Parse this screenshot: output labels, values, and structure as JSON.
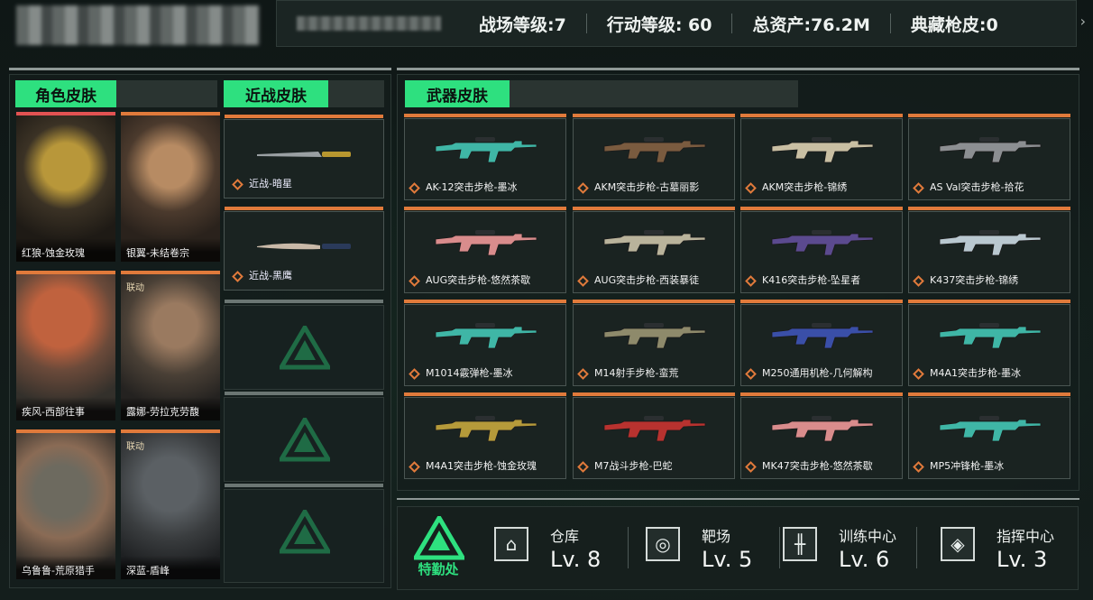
{
  "header": {
    "battlefield_level": "战场等级:7",
    "action_level": "行动等级: 60",
    "total_assets": "总资产:76.2M",
    "collection_skins": "典藏枪皮:0"
  },
  "sections": {
    "characters": "角色皮肤",
    "melee": "近战皮肤",
    "weapons": "武器皮肤"
  },
  "characters": [
    {
      "name": "红狼-蚀金玫瑰",
      "collab": ""
    },
    {
      "name": "银翼-未结卷宗",
      "collab": ""
    },
    {
      "name": "疾风-西部往事",
      "collab": ""
    },
    {
      "name": "露娜-劳拉克劳馥",
      "collab": "联动"
    },
    {
      "name": "乌鲁鲁-荒原猎手",
      "collab": ""
    },
    {
      "name": "深蓝-盾峰",
      "collab": "联动"
    }
  ],
  "melee": [
    {
      "name": "近战-暗星"
    },
    {
      "name": "近战-黑鹰"
    }
  ],
  "weapons": [
    {
      "name": "AK-12突击步枪-墨冰",
      "color": "#3fb6a6"
    },
    {
      "name": "AKM突击步枪-古墓丽影",
      "color": "#7a5b3f"
    },
    {
      "name": "AKM突击步枪-锦绣",
      "color": "#c9bfa3"
    },
    {
      "name": "AS Val突击步枪-拾花",
      "color": "#8c8f92"
    },
    {
      "name": "AUG突击步枪-悠然茶歇",
      "color": "#d98c8c"
    },
    {
      "name": "AUG突击步枪-西装暴徒",
      "color": "#b9b39b"
    },
    {
      "name": "K416突击步枪-坠星者",
      "color": "#5b4a8f"
    },
    {
      "name": "K437突击步枪-锦绣",
      "color": "#b9c8d0"
    },
    {
      "name": "M1014霰弹枪-墨冰",
      "color": "#3fb6a6"
    },
    {
      "name": "M14射手步枪-蛮荒",
      "color": "#8e8a6b"
    },
    {
      "name": "M250通用机枪-几何解构",
      "color": "#3a4fa8"
    },
    {
      "name": "M4A1突击步枪-墨冰",
      "color": "#3fb6a6"
    },
    {
      "name": "M4A1突击步枪-蚀金玫瑰",
      "color": "#b59a3a"
    },
    {
      "name": "M7战斗步枪-巴蛇",
      "color": "#b8322f"
    },
    {
      "name": "MK47突击步枪-悠然茶歇",
      "color": "#d98c8c"
    },
    {
      "name": "MP5冲锋枪-墨冰",
      "color": "#3fb6a6"
    }
  ],
  "hq": {
    "name": "特勤处",
    "facilities": [
      {
        "name": "仓库",
        "level": "Lv. 8",
        "icon": "warehouse-icon"
      },
      {
        "name": "靶场",
        "level": "Lv. 5",
        "icon": "target-icon"
      },
      {
        "name": "训练中心",
        "level": "Lv. 6",
        "icon": "dumbbell-icon"
      },
      {
        "name": "指挥中心",
        "level": "Lv. 3",
        "icon": "command-icon"
      }
    ]
  }
}
